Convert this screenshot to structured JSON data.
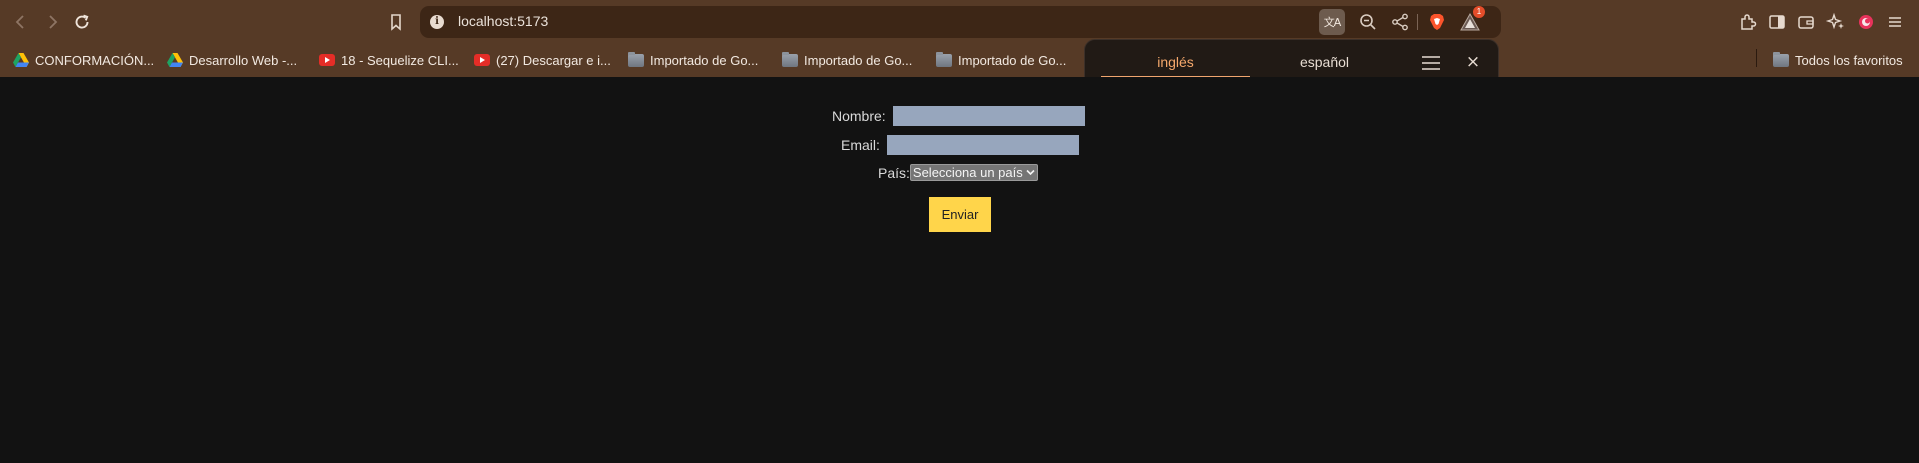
{
  "browser": {
    "url": "localhost:5173",
    "rewards_badge_count": "1",
    "translate_icon_glyph": "文A",
    "icons": [
      "back-icon",
      "forward-icon",
      "reload-icon",
      "bookmark-icon",
      "site-info-icon",
      "translate-icon",
      "zoom-out-icon",
      "share-icon",
      "brave-shield-icon",
      "brave-rewards-icon",
      "extensions-icon",
      "sidebar-icon",
      "wallet-icon",
      "leo-ai-icon",
      "profile-icon",
      "menu-icon"
    ]
  },
  "bookmarks": {
    "items": [
      {
        "label": "CONFORMACIÓN...",
        "icon": "google-drive-icon"
      },
      {
        "label": "Desarrollo Web -...",
        "icon": "google-drive-icon"
      },
      {
        "label": "18 - Sequelize CLI...",
        "icon": "youtube-icon"
      },
      {
        "label": "(27) Descargar e i...",
        "icon": "youtube-icon"
      },
      {
        "label": "Importado de Go...",
        "icon": "folder-icon"
      },
      {
        "label": "Importado de Go...",
        "icon": "folder-icon"
      },
      {
        "label": "Importado de Go...",
        "icon": "folder-icon"
      }
    ],
    "all_bookmarks": "Todos los favoritos"
  },
  "translate_popup": {
    "source_lang": "inglés",
    "target_lang": "español",
    "active_tab": "inglés",
    "close_glyph": "×"
  },
  "form": {
    "name_label": "Nombre:",
    "name_value": "",
    "email_label": "Email:",
    "email_value": "",
    "country_label": "País:",
    "country_selected": "Selecciona un país",
    "submit_label": "Enviar"
  },
  "colors": {
    "chrome_bg": "#563a26",
    "urlbar_bg": "#3d2616",
    "page_bg": "#121212",
    "input_bg": "#97a6bd",
    "submit_bg": "#ffd54a",
    "accent_tab": "#f5a86c"
  }
}
